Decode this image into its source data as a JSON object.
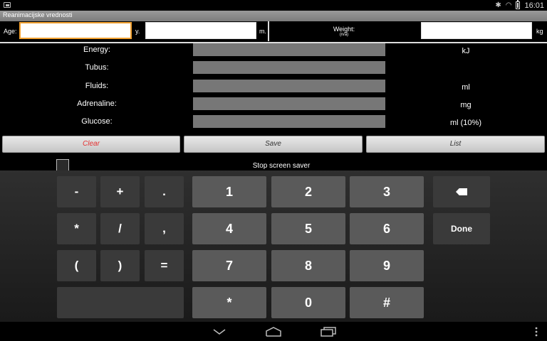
{
  "status": {
    "time": "16:01",
    "left_icon": "image-notification-icon",
    "icons": [
      "bluetooth-icon",
      "wifi-icon",
      "battery-icon"
    ]
  },
  "app": {
    "title": "Reanimacijske vrednosti"
  },
  "header": {
    "age_label": "Age:",
    "age_value": "",
    "years_unit": "y.",
    "months_value": "",
    "months_unit": "m.",
    "weight_label": "Weight:",
    "weight_hint": "(n/a)",
    "weight_value": "",
    "weight_unit": "kg"
  },
  "results": [
    {
      "label": "Energy:",
      "unit": "kJ"
    },
    {
      "label": "Tubus:",
      "unit": ""
    },
    {
      "label": "Fluids:",
      "unit": "ml"
    },
    {
      "label": "Adrenaline:",
      "unit": "mg"
    },
    {
      "label": "Glucose:",
      "unit": "ml (10%)"
    }
  ],
  "actions": {
    "clear": "Clear",
    "save": "Save",
    "list": "List"
  },
  "screen_saver": {
    "label": "Stop screen saver",
    "checked": false
  },
  "keyboard": {
    "sym": [
      "-",
      "+",
      ".",
      "*",
      "/",
      ",",
      "(",
      ")",
      "="
    ],
    "num": [
      "1",
      "2",
      "3",
      "4",
      "5",
      "6",
      "7",
      "8",
      "9",
      "*",
      "0",
      "#"
    ],
    "done": "Done",
    "backspace_icon": "backspace-icon"
  },
  "nav": {
    "icons": [
      "back-icon",
      "home-icon",
      "recents-icon",
      "menu-icon"
    ]
  },
  "colors": {
    "focus": "#f0a030",
    "clear_text": "#e53030"
  }
}
